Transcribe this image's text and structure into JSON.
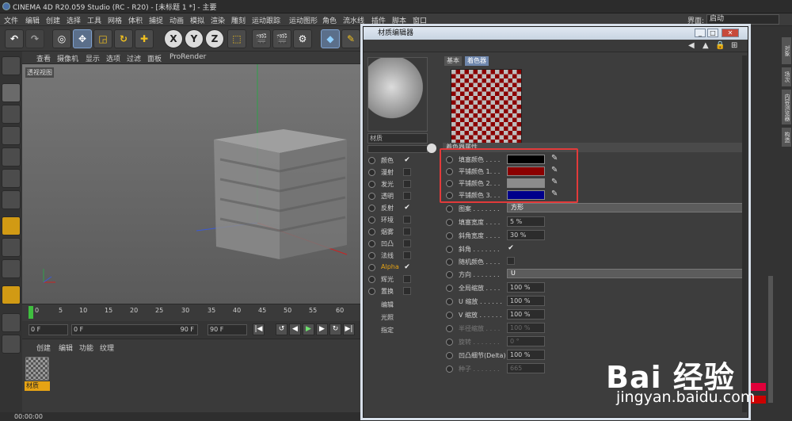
{
  "app": {
    "title": "CINEMA 4D R20.059 Studio (RC - R20) - [未标题 1 *] - 主要"
  },
  "menu": [
    "文件",
    "编辑",
    "创建",
    "选择",
    "工具",
    "网格",
    "体积",
    "捕捉",
    "动画",
    "模拟",
    "渲染",
    "雕刻",
    "运动跟踪",
    "运动图形",
    "角色",
    "流水线",
    "插件",
    "脚本",
    "窗口"
  ],
  "layout": {
    "label": "界面:",
    "value": "启动"
  },
  "toolbar": {
    "axis_x": "X",
    "axis_y": "Y",
    "axis_z": "Z"
  },
  "viewport": {
    "menu": [
      "查看",
      "摄像机",
      "显示",
      "选项",
      "过滤",
      "面板",
      "ProRender"
    ],
    "label": "透视视图"
  },
  "timeline": {
    "ticks": [
      "0",
      "5",
      "10",
      "15",
      "20",
      "25",
      "30",
      "35",
      "40",
      "45",
      "50",
      "55",
      "60"
    ],
    "start_field": "0 F",
    "current_field": "0 F",
    "range_end": "90 F",
    "end_field": "90 F"
  },
  "material_manager": {
    "menu": [
      "创建",
      "编辑",
      "功能",
      "纹理"
    ],
    "material_name": "材质"
  },
  "status": {
    "time": "00:00:00"
  },
  "dialog": {
    "title": "材质编辑器",
    "material_name": "材质",
    "tabs": [
      "基本",
      "着色器"
    ],
    "section_title": "着色器属性",
    "channels": [
      {
        "label": "颜色",
        "checked": true
      },
      {
        "label": "漫射",
        "checked": false
      },
      {
        "label": "发光",
        "checked": false
      },
      {
        "label": "透明",
        "checked": false
      },
      {
        "label": "反射",
        "checked": true
      },
      {
        "label": "环境",
        "checked": false
      },
      {
        "label": "烟雾",
        "checked": false
      },
      {
        "label": "凹凸",
        "checked": false
      },
      {
        "label": "法线",
        "checked": false
      },
      {
        "label": "Alpha",
        "checked": true
      },
      {
        "label": "辉光",
        "checked": false
      },
      {
        "label": "置换",
        "checked": false
      }
    ],
    "extra_items": [
      "编辑",
      "光照",
      "指定"
    ],
    "colors": [
      {
        "label": "填塞颜色 . . . .",
        "color": "#000000"
      },
      {
        "label": "平铺颜色 1. . .",
        "color": "#8b0000"
      },
      {
        "label": "平铺颜色 2. . .",
        "color": "#8c8c8c"
      },
      {
        "label": "平铺颜色 3. . .",
        "color": "#00008b"
      }
    ],
    "params": [
      {
        "label": "图案 . . . . . . .",
        "type": "dropdown",
        "value": "方形"
      },
      {
        "label": "填塞宽度 . . . .",
        "type": "number",
        "value": "5 %"
      },
      {
        "label": "斜角宽度 . . . .",
        "type": "number",
        "value": "30 %"
      },
      {
        "label": "斜角 . . . . . . .",
        "type": "check",
        "value": "✔"
      },
      {
        "label": "随机颜色 . . . .",
        "type": "check",
        "value": ""
      },
      {
        "label": "方向 . . . . . . .",
        "type": "dropdown",
        "value": "U"
      },
      {
        "label": "全局缩放 . . . .",
        "type": "number",
        "value": "100 %"
      },
      {
        "label": "U 缩放 . . . . . .",
        "type": "number",
        "value": "100 %"
      },
      {
        "label": "V 缩放 . . . . . .",
        "type": "number",
        "value": "100 %"
      },
      {
        "label": "半径缩放 . . . .",
        "type": "number",
        "value": "100 %",
        "dim": true
      },
      {
        "label": "旋转 . . . . . . .",
        "type": "number",
        "value": "0 °",
        "dim": true
      },
      {
        "label": "凹凸细节(Delta)",
        "type": "number",
        "value": "100 %"
      },
      {
        "label": "种子 . . . . . . .",
        "type": "number",
        "value": "665",
        "dim": true
      }
    ]
  },
  "right_tabs": [
    "对象",
    "场次",
    "内容浏览器",
    "构造"
  ],
  "watermark": {
    "main": "Bai 经验",
    "sub": "jingyan.baidu.com"
  }
}
